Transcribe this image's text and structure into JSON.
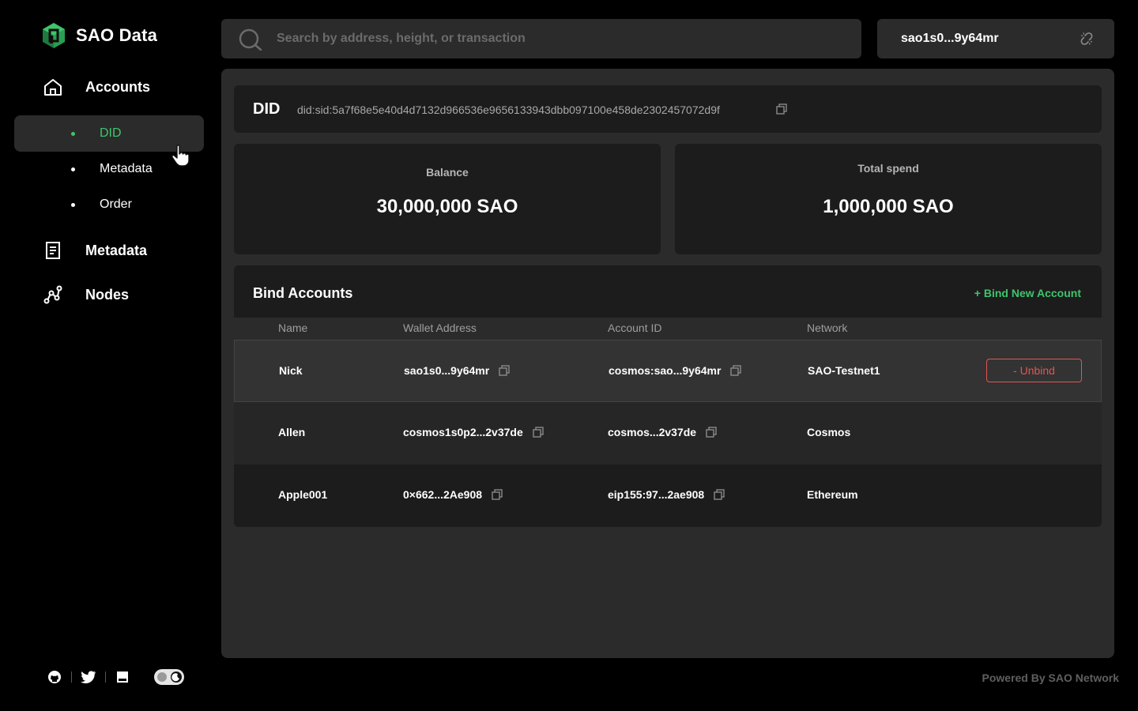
{
  "brand": {
    "name": "SAO Data"
  },
  "sidebar": {
    "accounts_label": "Accounts",
    "sub_items": [
      {
        "label": "DID",
        "active": true
      },
      {
        "label": "Metadata",
        "active": false
      },
      {
        "label": "Order",
        "active": false
      }
    ],
    "metadata_label": "Metadata",
    "nodes_label": "Nodes"
  },
  "search": {
    "placeholder": "Search by address, height, or transaction"
  },
  "wallet": {
    "address": "sao1s0...9y64mr"
  },
  "did": {
    "title": "DID",
    "value": "did:sid:5a7f68e5e40d4d7132d966536e9656133943dbb097100e458de2302457072d9f"
  },
  "stats": {
    "balance_label": "Balance",
    "balance_value": "30,000,000 SAO",
    "spend_label": "Total spend",
    "spend_value": "1,000,000 SAO"
  },
  "bind": {
    "title": "Bind Accounts",
    "new_label": "+ Bind New Account",
    "columns": [
      "Name",
      "Wallet Address",
      "Account ID",
      "Network"
    ],
    "unbind_label": "- Unbind",
    "rows": [
      {
        "name": "Nick",
        "wallet": "sao1s0...9y64mr",
        "account": "cosmos:sao...9y64mr",
        "network": "SAO-Testnet1"
      },
      {
        "name": "Allen",
        "wallet": "cosmos1s0p2...2v37de",
        "account": "cosmos...2v37de",
        "network": "Cosmos"
      },
      {
        "name": "Apple001",
        "wallet": "0×662...2Ae908",
        "account": "eip155:97...2ae908",
        "network": "Ethereum"
      }
    ]
  },
  "footer": {
    "text": "Powered By SAO Network"
  },
  "colors": {
    "accent": "#3ec46d",
    "danger": "#e05555",
    "panel": "#2b2b2b",
    "card": "#1c1c1c"
  }
}
